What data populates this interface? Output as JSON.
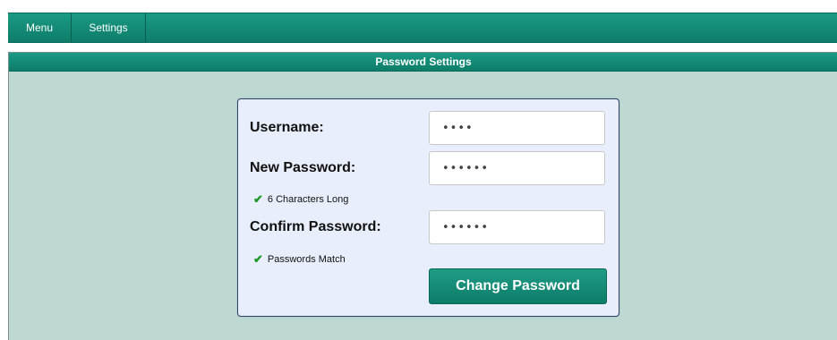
{
  "nav": {
    "items": [
      {
        "label": "Menu"
      },
      {
        "label": "Settings"
      }
    ]
  },
  "panel": {
    "title": "Password Settings"
  },
  "form": {
    "username_label": "Username:",
    "username_value": "••••",
    "new_password_label": "New Password:",
    "new_password_value": "••••••",
    "length_hint": "6 Characters Long",
    "confirm_password_label": "Confirm Password:",
    "confirm_password_value": "••••••",
    "match_hint": "Passwords Match",
    "submit_label": "Change Password"
  },
  "icons": {
    "check": "check-icon"
  },
  "colors": {
    "accent": "#0e7d6a",
    "panel_bg": "#bed8d2",
    "form_bg": "#e8eefb",
    "check": "#1f9a2a"
  }
}
